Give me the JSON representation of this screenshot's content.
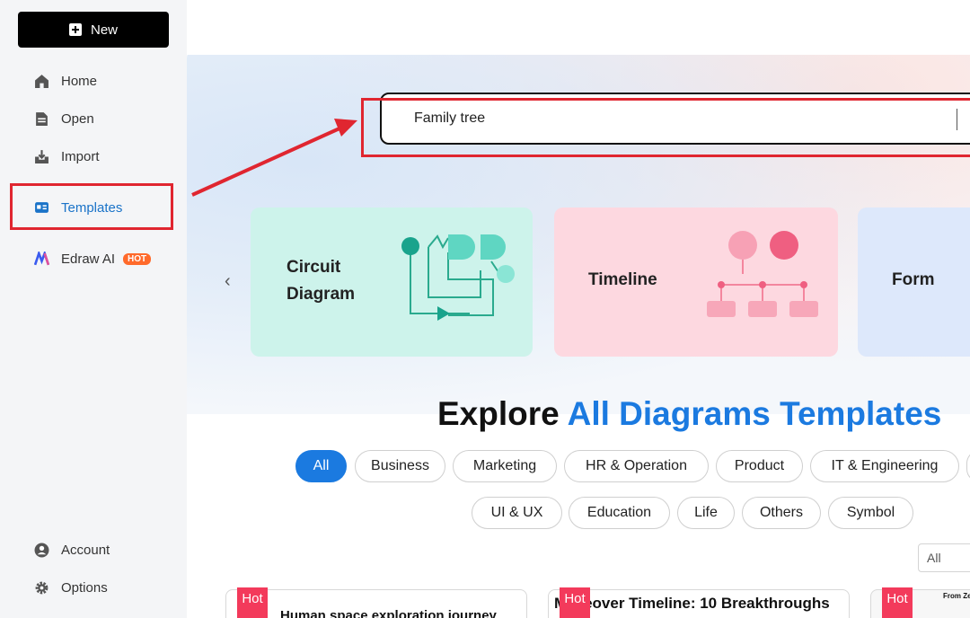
{
  "sidebar": {
    "new_label": "New",
    "items": [
      {
        "label": "Home"
      },
      {
        "label": "Open"
      },
      {
        "label": "Import"
      },
      {
        "label": "Templates"
      },
      {
        "label": "Edraw AI",
        "badge": "HOT"
      }
    ],
    "bottom": [
      {
        "label": "Account"
      },
      {
        "label": "Options"
      }
    ]
  },
  "search": {
    "value": "Family tree"
  },
  "cards": [
    {
      "line1": "Circuit",
      "line2": "Diagram"
    },
    {
      "label": "Timeline"
    },
    {
      "label": "Form"
    }
  ],
  "explore": {
    "prefix": "Explore ",
    "highlight": "All Diagrams Templates"
  },
  "chips_row1": [
    "All",
    "Business",
    "Marketing",
    "HR & Operation",
    "Product",
    "IT & Engineering"
  ],
  "chips_row2": [
    "UI & UX",
    "Education",
    "Life",
    "Others",
    "Symbol"
  ],
  "filter_select": "All",
  "templates": [
    {
      "tag": "Hot",
      "title": "Human space exploration journey"
    },
    {
      "tag": "Hot",
      "title": "Makeover Timeline: 10 Breakthroughs"
    },
    {
      "tag": "Hot",
      "title": "From Ze"
    }
  ],
  "colors": {
    "accent": "#1b7ae0",
    "highlight_box": "#e02630",
    "hot": "#f33a5b"
  }
}
